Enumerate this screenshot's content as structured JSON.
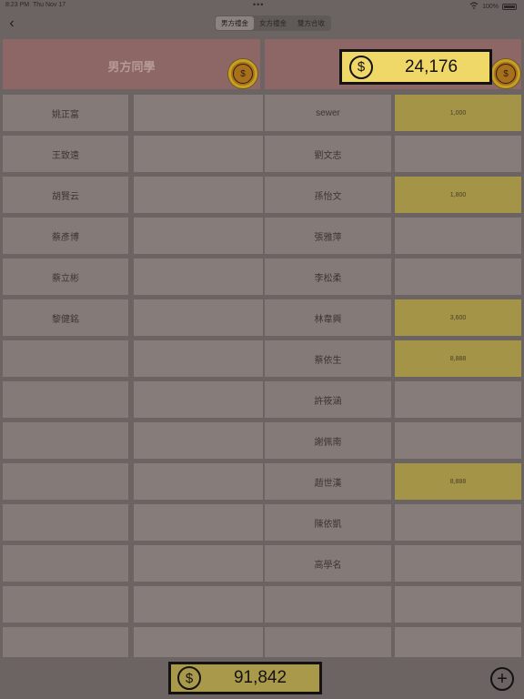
{
  "status": {
    "time": "8:23 PM",
    "date": "Thu Nov 17",
    "dots": "•••",
    "battery": "100%"
  },
  "nav": {
    "back": "‹",
    "tabs": [
      "男方禮金",
      "女方禮金",
      "雙方合收"
    ],
    "active_tab": 0
  },
  "header": {
    "left_title": "男方同學",
    "coin_symbol": "$",
    "right_total": "24,176"
  },
  "left_names": [
    "姚正富",
    "王致遠",
    "胡賢云",
    "蔡彥博",
    "蔡立彬",
    "黎健銘",
    "",
    "",
    "",
    "",
    "",
    "",
    "",
    ""
  ],
  "left_amounts": [
    "",
    "",
    "",
    "",
    "",
    "",
    "",
    "",
    "",
    "",
    "",
    "",
    "",
    ""
  ],
  "right_names": [
    "sewer",
    "劉文志",
    "孫怡文",
    "張雅萍",
    "李松柔",
    "林韋興",
    "蔡依生",
    "許筱涵",
    "謝佩南",
    "趙世漢",
    "陳依凱",
    "高學名",
    "",
    ""
  ],
  "right_amounts": [
    "1,000",
    "",
    "1,800",
    "",
    "",
    "3,600",
    "8,888",
    "",
    "",
    "8,888",
    "",
    "",
    "",
    ""
  ],
  "footer": {
    "grand_total": "91,842",
    "add_symbol": "+"
  },
  "colors": {
    "background": "#6b6462",
    "header": "#8d6666",
    "cell": "#847a78",
    "gold_cell": "#a39448",
    "pill": "#f0d868"
  }
}
